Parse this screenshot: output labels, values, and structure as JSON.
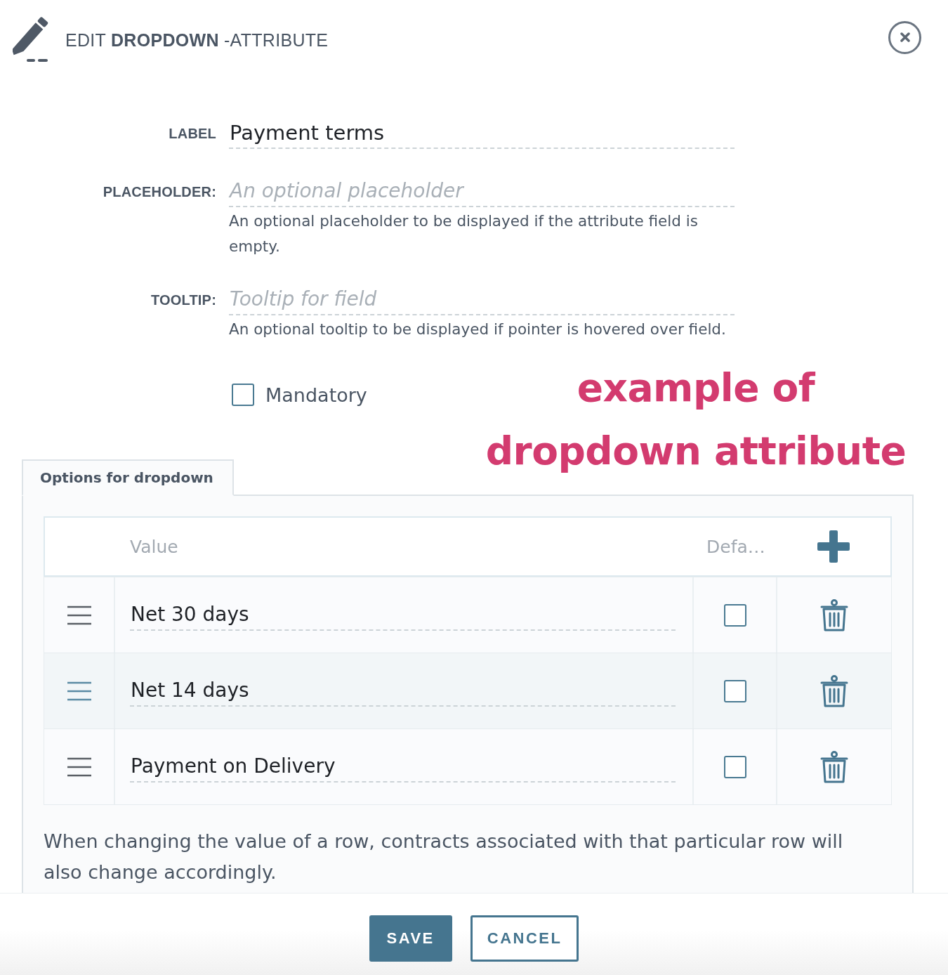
{
  "dialog": {
    "title": "EDIT **DROPDOWN** -ATTRIBUTE"
  },
  "fields": [
    {
      "label": "LABEL",
      "value": "Payment terms"
    },
    {
      "label": "PLACEHOLDER:",
      "placeholder": "An optional placeholder",
      "help": "An optional placeholder to be displayed if the attribute field is empty."
    },
    {
      "label": "TOOLTIP:",
      "placeholder": "Tooltip for field",
      "help": "An optional tooltip to be displayed if pointer is hovered over field."
    }
  ],
  "mandatory": {
    "label": "Mandatory",
    "checked": false
  },
  "annotation": "example of dropdown attribute",
  "tabs": [
    {
      "label": "Options for dropdown",
      "selected": true
    }
  ],
  "options_table": {
    "columns": [
      "Value",
      "Defa…"
    ],
    "rows": [
      {
        "value": "Net 30 days",
        "default": false,
        "hovered": false
      },
      {
        "value": "Net 14 days",
        "default": false,
        "hovered": true
      },
      {
        "value": "Payment on Delivery",
        "default": false,
        "hovered": false
      }
    ]
  },
  "note": "When changing the value of a row, contracts associated with that particular row will also change accordingly.",
  "buttons": [
    {
      "label": "SAVE",
      "kind": "primary"
    },
    {
      "label": "CANCEL",
      "kind": "secondary"
    }
  ]
}
